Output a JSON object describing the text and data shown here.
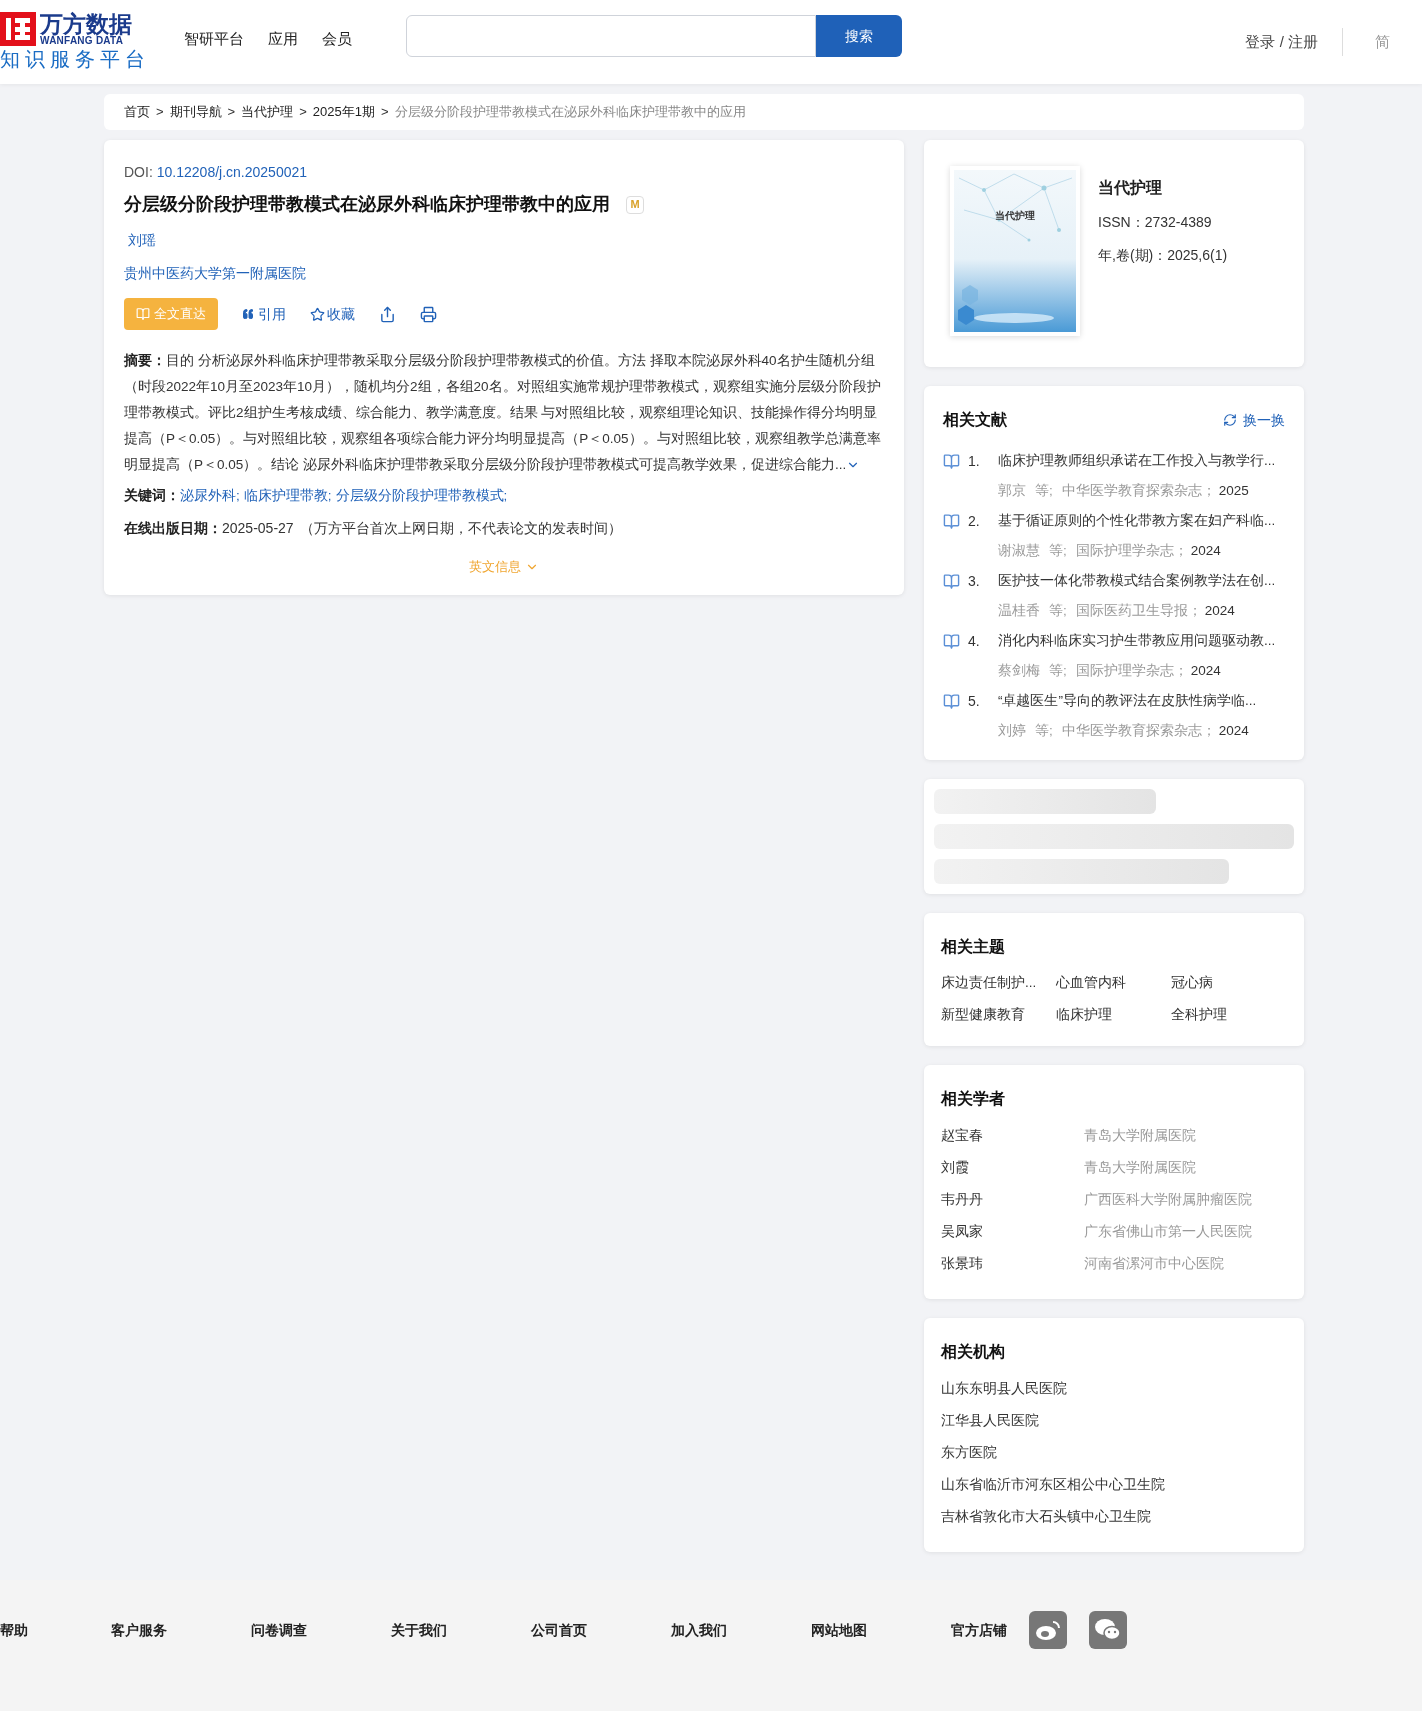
{
  "header": {
    "logo": {
      "name_cn": "万方数据",
      "name_en": "WANFANG DATA",
      "platform": "知识服务平台"
    },
    "nav": [
      "智研平台",
      "应用",
      "会员"
    ],
    "search": {
      "button": "搜索"
    },
    "login": "登录 / 注册",
    "lang": {
      "label": "简",
      "selected": true
    }
  },
  "breadcrumb": {
    "links": [
      "首页",
      "期刊导航",
      "当代护理",
      "2025年1期"
    ],
    "separator": ">",
    "current": "分层级分阶段护理带教模式在泌尿外科临床护理带教中的应用"
  },
  "article": {
    "doi_label": "DOI:",
    "doi": "10.12208/j.cn.20250021",
    "title": "分层级分阶段护理带教模式在泌尿外科临床护理带教中的应用",
    "badge": "M",
    "author": "刘瑶",
    "affiliation": "贵州中医药大学第一附属医院",
    "actions": [
      {
        "kind": "primary",
        "label": "全文直达"
      },
      {
        "kind": "cite",
        "label": "引用"
      },
      {
        "kind": "star",
        "label": "收藏"
      },
      {
        "kind": "share"
      },
      {
        "kind": "print"
      }
    ],
    "abstract_label": "摘要：",
    "abstract": "目的 分析泌尿外科临床护理带教采取分层级分阶段护理带教模式的价值。方法 择取本院泌尿外科40名护生随机分组（时段2022年10月至2023年10月），随机均分2组，各组20名。对照组实施常规护理带教模式，观察组实施分层级分阶段护理带教模式。评比2组护生考核成绩、综合能力、教学满意度。结果 与对照组比较，观察组理论知识、技能操作得分均明显提高（P＜0.05）。与对照组比较，观察组各项综合能力评分均明显提高（P＜0.05）。与对照组比较，观察组教学总满意率明显提高（P＜0.05）。结论 泌尿外科临床护理带教采取分层级分阶段护理带教模式可提高教学效果，促进综合能力...",
    "keywords_label": "关键词：",
    "keywords": [
      "泌尿外科",
      "临床护理带教",
      "分层级分阶段护理带教模式"
    ],
    "keyword_separator": ";",
    "date_label": "在线出版日期：",
    "date": "2025-05-27",
    "date_note": "（万方平台首次上网日期，不代表论文的发表时间）",
    "english_toggle": "英文信息"
  },
  "journal": {
    "cover_title": "当代护理",
    "name": "当代护理",
    "issn": "ISSN：2732-4389",
    "issue": "年,卷(期)：2025,6(1)"
  },
  "related_docs": {
    "title": "相关文献",
    "refresh": "换一换",
    "items": [
      {
        "num": "1.",
        "title": "临床护理教师组织承诺在工作投入与教学行...",
        "author": "郭京",
        "etal": "等;",
        "source": "中华医学教育探索杂志；",
        "year": "2025"
      },
      {
        "num": "2.",
        "title": "基于循证原则的个性化带教方案在妇产科临...",
        "author": "谢淑慧",
        "etal": "等;",
        "source": "国际护理学杂志；",
        "year": "2024"
      },
      {
        "num": "3.",
        "title": "医护技一体化带教模式结合案例教学法在创...",
        "author": "温桂香",
        "etal": "等;",
        "source": "国际医药卫生导报；",
        "year": "2024"
      },
      {
        "num": "4.",
        "title": "消化内科临床实习护生带教应用问题驱动教...",
        "author": "蔡剑梅",
        "etal": "等;",
        "source": "国际护理学杂志；",
        "year": "2024"
      },
      {
        "num": "5.",
        "title": "“卓越医生”导向的教评法在皮肤性病学临...",
        "author": "刘婷",
        "etal": "等;",
        "source": "中华医学教育探索杂志；",
        "year": "2024"
      }
    ]
  },
  "related_topics": {
    "title": "相关主题",
    "items": [
      "床边责任制护...",
      "心血管内科",
      "冠心病",
      "新型健康教育",
      "临床护理",
      "全科护理"
    ]
  },
  "related_scholars": {
    "title": "相关学者",
    "items": [
      {
        "name": "赵宝春",
        "org": "青岛大学附属医院"
      },
      {
        "name": "刘霞",
        "org": "青岛大学附属医院"
      },
      {
        "name": "韦丹丹",
        "org": "广西医科大学附属肿瘤医院"
      },
      {
        "name": "吴凤家",
        "org": "广东省佛山市第一人民医院"
      },
      {
        "name": "张景玮",
        "org": "河南省漯河市中心医院"
      }
    ]
  },
  "related_orgs": {
    "title": "相关机构",
    "items": [
      "山东东明县人民医院",
      "江华县人民医院",
      "东方医院",
      "山东省临沂市河东区相公中心卫生院",
      "吉林省敦化市大石头镇中心卫生院"
    ]
  },
  "footer": {
    "links": [
      "帮助",
      "客户服务",
      "问卷调查",
      "关于我们",
      "公司首页",
      "加入我们",
      "网站地图",
      "官方店铺"
    ]
  }
}
